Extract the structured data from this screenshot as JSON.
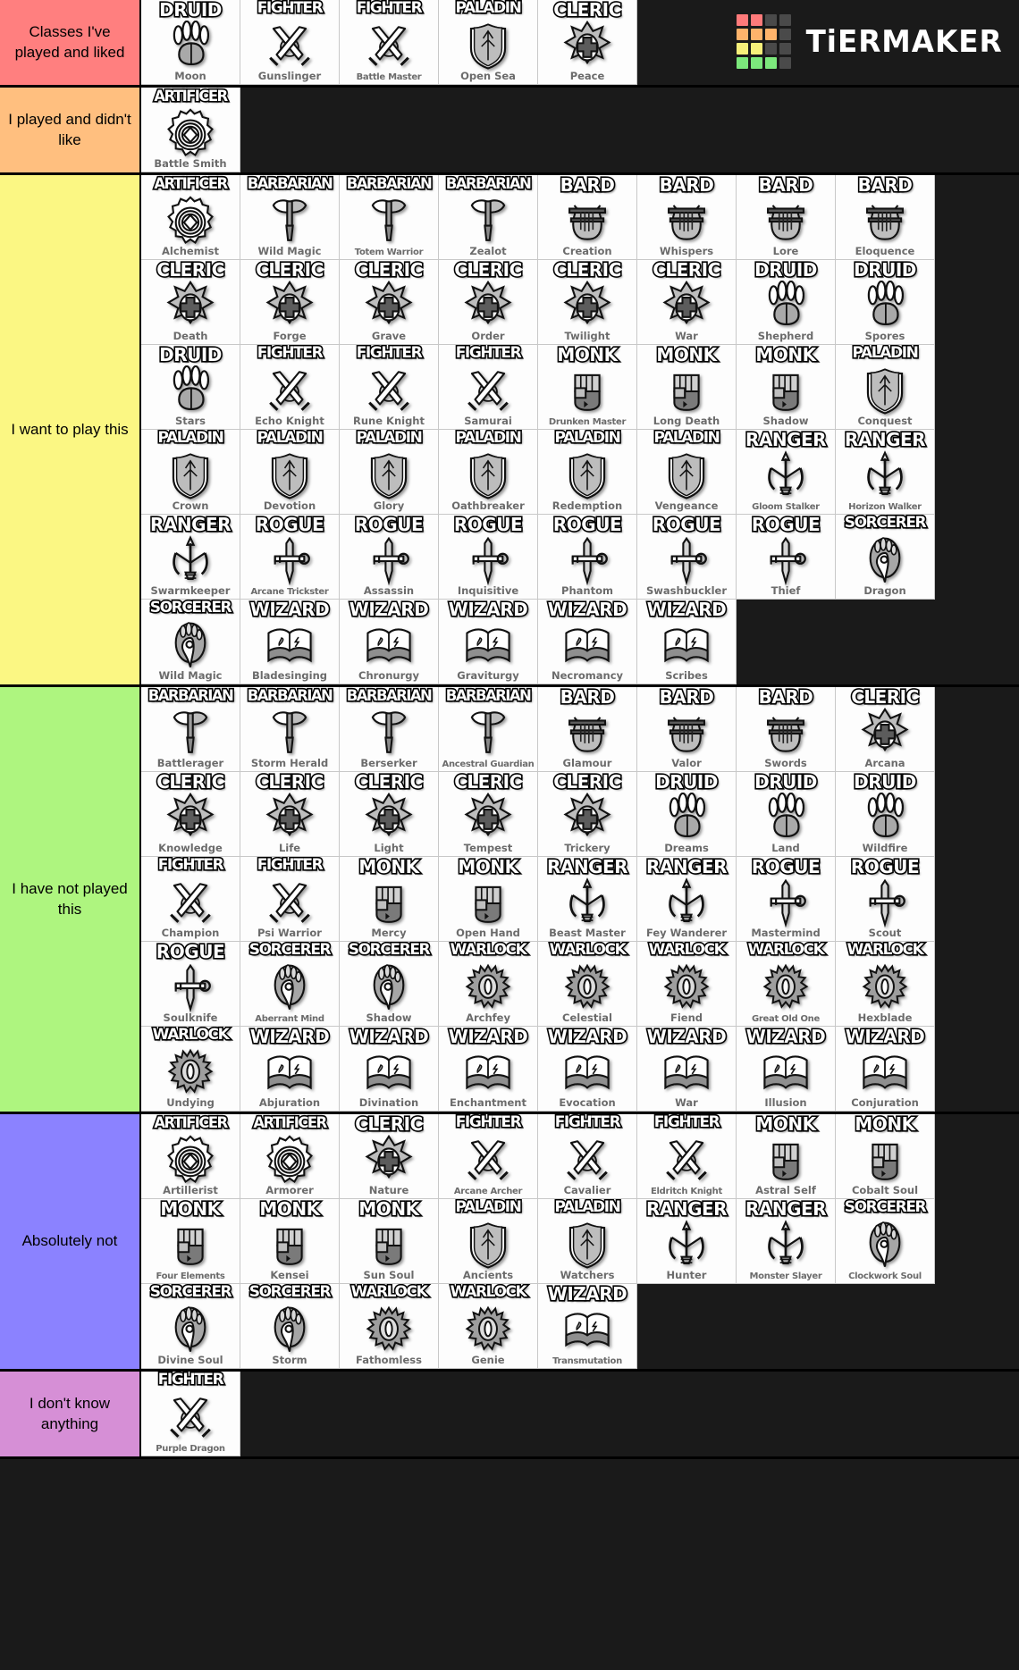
{
  "brand": {
    "name": "TiERMAKER",
    "logo_colors": [
      [
        "#ff7a7a",
        "#ff7a7a",
        "#4a4a4a",
        "#4a4a4a"
      ],
      [
        "#ffb36b",
        "#ffb36b",
        "#ffb36b",
        "#4a4a4a"
      ],
      [
        "#f7f07a",
        "#f7f07a",
        "#4a4a4a",
        "#4a4a4a"
      ],
      [
        "#7ce87c",
        "#7ce87c",
        "#7ce87c",
        "#4a4a4a"
      ]
    ]
  },
  "tiers": [
    {
      "label": "Classes I've played and liked",
      "color": "#ff7f7f",
      "items": [
        {
          "cls": "DRUID",
          "sub": "Moon",
          "icon": "paw-icon"
        },
        {
          "cls": "FIGHTER",
          "sub": "Gunslinger",
          "icon": "swords-icon"
        },
        {
          "cls": "FIGHTER",
          "sub": "Battle Master",
          "icon": "swords-icon"
        },
        {
          "cls": "PALADIN",
          "sub": "Open Sea",
          "icon": "shield-icon"
        },
        {
          "cls": "CLERIC",
          "sub": "Peace",
          "icon": "cross-icon"
        }
      ]
    },
    {
      "label": "I played and didn't like",
      "color": "#ffbf7f",
      "items": [
        {
          "cls": "ARTIFICER",
          "sub": "Battle Smith",
          "icon": "gear-icon"
        }
      ]
    },
    {
      "label": "I want to play this",
      "color": "#fbf783",
      "items": [
        {
          "cls": "ARTIFICER",
          "sub": "Alchemist",
          "icon": "gear-icon"
        },
        {
          "cls": "BARBARIAN",
          "sub": "Wild Magic",
          "icon": "axe-icon"
        },
        {
          "cls": "BARBARIAN",
          "sub": "Totem Warrior",
          "icon": "axe-icon"
        },
        {
          "cls": "BARBARIAN",
          "sub": "Zealot",
          "icon": "axe-icon"
        },
        {
          "cls": "BARD",
          "sub": "Creation",
          "icon": "lyre-icon"
        },
        {
          "cls": "BARD",
          "sub": "Whispers",
          "icon": "lyre-icon"
        },
        {
          "cls": "BARD",
          "sub": "Lore",
          "icon": "lyre-icon"
        },
        {
          "cls": "BARD",
          "sub": "Eloquence",
          "icon": "lyre-icon"
        },
        {
          "cls": "CLERIC",
          "sub": "Death",
          "icon": "cross-icon"
        },
        {
          "cls": "CLERIC",
          "sub": "Forge",
          "icon": "cross-icon"
        },
        {
          "cls": "CLERIC",
          "sub": "Grave",
          "icon": "cross-icon"
        },
        {
          "cls": "CLERIC",
          "sub": "Order",
          "icon": "cross-icon"
        },
        {
          "cls": "CLERIC",
          "sub": "Twilight",
          "icon": "cross-icon"
        },
        {
          "cls": "CLERIC",
          "sub": "War",
          "icon": "cross-icon"
        },
        {
          "cls": "DRUID",
          "sub": "Shepherd",
          "icon": "paw-icon"
        },
        {
          "cls": "DRUID",
          "sub": "Spores",
          "icon": "paw-icon"
        },
        {
          "cls": "DRUID",
          "sub": "Stars",
          "icon": "paw-icon"
        },
        {
          "cls": "FIGHTER",
          "sub": "Echo Knight",
          "icon": "swords-icon"
        },
        {
          "cls": "FIGHTER",
          "sub": "Rune Knight",
          "icon": "swords-icon"
        },
        {
          "cls": "FIGHTER",
          "sub": "Samurai",
          "icon": "swords-icon"
        },
        {
          "cls": "MONK",
          "sub": "Drunken Master",
          "icon": "fist-icon"
        },
        {
          "cls": "MONK",
          "sub": "Long Death",
          "icon": "fist-icon"
        },
        {
          "cls": "MONK",
          "sub": "Shadow",
          "icon": "fist-icon"
        },
        {
          "cls": "PALADIN",
          "sub": "Conquest",
          "icon": "shield-icon"
        },
        {
          "cls": "PALADIN",
          "sub": "Crown",
          "icon": "shield-icon"
        },
        {
          "cls": "PALADIN",
          "sub": "Devotion",
          "icon": "shield-icon"
        },
        {
          "cls": "PALADIN",
          "sub": "Glory",
          "icon": "shield-icon"
        },
        {
          "cls": "PALADIN",
          "sub": "Oathbreaker",
          "icon": "shield-icon"
        },
        {
          "cls": "PALADIN",
          "sub": "Redemption",
          "icon": "shield-icon"
        },
        {
          "cls": "PALADIN",
          "sub": "Vengeance",
          "icon": "shield-icon"
        },
        {
          "cls": "RANGER",
          "sub": "Gloom Stalker",
          "icon": "bow-icon"
        },
        {
          "cls": "RANGER",
          "sub": "Horizon Walker",
          "icon": "bow-icon"
        },
        {
          "cls": "RANGER",
          "sub": "Swarmkeeper",
          "icon": "bow-icon"
        },
        {
          "cls": "ROGUE",
          "sub": "Arcane Trickster",
          "icon": "dagger-icon"
        },
        {
          "cls": "ROGUE",
          "sub": "Assassin",
          "icon": "dagger-icon"
        },
        {
          "cls": "ROGUE",
          "sub": "Inquisitive",
          "icon": "dagger-icon"
        },
        {
          "cls": "ROGUE",
          "sub": "Phantom",
          "icon": "dagger-icon"
        },
        {
          "cls": "ROGUE",
          "sub": "Swashbuckler",
          "icon": "dagger-icon"
        },
        {
          "cls": "ROGUE",
          "sub": "Thief",
          "icon": "dagger-icon"
        },
        {
          "cls": "SORCERER",
          "sub": "Dragon",
          "icon": "flame-icon"
        },
        {
          "cls": "SORCERER",
          "sub": "Wild Magic",
          "icon": "flame-icon"
        },
        {
          "cls": "WIZARD",
          "sub": "Bladesinging",
          "icon": "book-icon"
        },
        {
          "cls": "WIZARD",
          "sub": "Chronurgy",
          "icon": "book-icon"
        },
        {
          "cls": "WIZARD",
          "sub": "Graviturgy",
          "icon": "book-icon"
        },
        {
          "cls": "WIZARD",
          "sub": "Necromancy",
          "icon": "book-icon"
        },
        {
          "cls": "WIZARD",
          "sub": "Scribes",
          "icon": "book-icon"
        }
      ]
    },
    {
      "label": "I have not played this",
      "color": "#aef57f",
      "items": [
        {
          "cls": "BARBARIAN",
          "sub": "Battlerager",
          "icon": "axe-icon"
        },
        {
          "cls": "BARBARIAN",
          "sub": "Storm Herald",
          "icon": "axe-icon"
        },
        {
          "cls": "BARBARIAN",
          "sub": "Berserker",
          "icon": "axe-icon"
        },
        {
          "cls": "BARBARIAN",
          "sub": "Ancestral Guardian",
          "icon": "axe-icon"
        },
        {
          "cls": "BARD",
          "sub": "Glamour",
          "icon": "lyre-icon"
        },
        {
          "cls": "BARD",
          "sub": "Valor",
          "icon": "lyre-icon"
        },
        {
          "cls": "BARD",
          "sub": "Swords",
          "icon": "lyre-icon"
        },
        {
          "cls": "CLERIC",
          "sub": "Arcana",
          "icon": "cross-icon"
        },
        {
          "cls": "CLERIC",
          "sub": "Knowledge",
          "icon": "cross-icon"
        },
        {
          "cls": "CLERIC",
          "sub": "Life",
          "icon": "cross-icon"
        },
        {
          "cls": "CLERIC",
          "sub": "Light",
          "icon": "cross-icon"
        },
        {
          "cls": "CLERIC",
          "sub": "Tempest",
          "icon": "cross-icon"
        },
        {
          "cls": "CLERIC",
          "sub": "Trickery",
          "icon": "cross-icon"
        },
        {
          "cls": "DRUID",
          "sub": "Dreams",
          "icon": "paw-icon"
        },
        {
          "cls": "DRUID",
          "sub": "Land",
          "icon": "paw-icon"
        },
        {
          "cls": "DRUID",
          "sub": "Wildfire",
          "icon": "paw-icon"
        },
        {
          "cls": "FIGHTER",
          "sub": "Champion",
          "icon": "swords-icon"
        },
        {
          "cls": "FIGHTER",
          "sub": "Psi Warrior",
          "icon": "swords-icon"
        },
        {
          "cls": "MONK",
          "sub": "Mercy",
          "icon": "fist-icon"
        },
        {
          "cls": "MONK",
          "sub": "Open Hand",
          "icon": "fist-icon"
        },
        {
          "cls": "RANGER",
          "sub": "Beast Master",
          "icon": "bow-icon"
        },
        {
          "cls": "RANGER",
          "sub": "Fey Wanderer",
          "icon": "bow-icon"
        },
        {
          "cls": "ROGUE",
          "sub": "Mastermind",
          "icon": "dagger-icon"
        },
        {
          "cls": "ROGUE",
          "sub": "Scout",
          "icon": "dagger-icon"
        },
        {
          "cls": "ROGUE",
          "sub": "Soulknife",
          "icon": "dagger-icon"
        },
        {
          "cls": "SORCERER",
          "sub": "Aberrant Mind",
          "icon": "flame-icon"
        },
        {
          "cls": "SORCERER",
          "sub": "Shadow",
          "icon": "flame-icon"
        },
        {
          "cls": "WARLOCK",
          "sub": "Archfey",
          "icon": "eye-icon"
        },
        {
          "cls": "WARLOCK",
          "sub": "Celestial",
          "icon": "eye-icon"
        },
        {
          "cls": "WARLOCK",
          "sub": "Fiend",
          "icon": "eye-icon"
        },
        {
          "cls": "WARLOCK",
          "sub": "Great Old One",
          "icon": "eye-icon"
        },
        {
          "cls": "WARLOCK",
          "sub": "Hexblade",
          "icon": "eye-icon"
        },
        {
          "cls": "WARLOCK",
          "sub": "Undying",
          "icon": "eye-icon"
        },
        {
          "cls": "WIZARD",
          "sub": "Abjuration",
          "icon": "book-icon"
        },
        {
          "cls": "WIZARD",
          "sub": "Divination",
          "icon": "book-icon"
        },
        {
          "cls": "WIZARD",
          "sub": "Enchantment",
          "icon": "book-icon"
        },
        {
          "cls": "WIZARD",
          "sub": "Evocation",
          "icon": "book-icon"
        },
        {
          "cls": "WIZARD",
          "sub": "War",
          "icon": "book-icon"
        },
        {
          "cls": "WIZARD",
          "sub": "Illusion",
          "icon": "book-icon"
        },
        {
          "cls": "WIZARD",
          "sub": "Conjuration",
          "icon": "book-icon"
        }
      ]
    },
    {
      "label": "Absolutely not",
      "color": "#8b82ff",
      "items": [
        {
          "cls": "ARTIFICER",
          "sub": "Artillerist",
          "icon": "gear-icon"
        },
        {
          "cls": "ARTIFICER",
          "sub": "Armorer",
          "icon": "gear-icon"
        },
        {
          "cls": "CLERIC",
          "sub": "Nature",
          "icon": "cross-icon"
        },
        {
          "cls": "FIGHTER",
          "sub": "Arcane Archer",
          "icon": "swords-icon"
        },
        {
          "cls": "FIGHTER",
          "sub": "Cavalier",
          "icon": "swords-icon"
        },
        {
          "cls": "FIGHTER",
          "sub": "Eldritch Knight",
          "icon": "swords-icon"
        },
        {
          "cls": "MONK",
          "sub": "Astral Self",
          "icon": "fist-icon"
        },
        {
          "cls": "MONK",
          "sub": "Cobalt Soul",
          "icon": "fist-icon"
        },
        {
          "cls": "MONK",
          "sub": "Four Elements",
          "icon": "fist-icon"
        },
        {
          "cls": "MONK",
          "sub": "Kensei",
          "icon": "fist-icon"
        },
        {
          "cls": "MONK",
          "sub": "Sun Soul",
          "icon": "fist-icon"
        },
        {
          "cls": "PALADIN",
          "sub": "Ancients",
          "icon": "shield-icon"
        },
        {
          "cls": "PALADIN",
          "sub": "Watchers",
          "icon": "shield-icon"
        },
        {
          "cls": "RANGER",
          "sub": "Hunter",
          "icon": "bow-icon"
        },
        {
          "cls": "RANGER",
          "sub": "Monster Slayer",
          "icon": "bow-icon"
        },
        {
          "cls": "SORCERER",
          "sub": "Clockwork Soul",
          "icon": "flame-icon"
        },
        {
          "cls": "SORCERER",
          "sub": "Divine Soul",
          "icon": "flame-icon"
        },
        {
          "cls": "SORCERER",
          "sub": "Storm",
          "icon": "flame-icon"
        },
        {
          "cls": "WARLOCK",
          "sub": "Fathomless",
          "icon": "eye-icon"
        },
        {
          "cls": "WARLOCK",
          "sub": "Genie",
          "icon": "eye-icon"
        },
        {
          "cls": "WIZARD",
          "sub": "Transmutation",
          "icon": "book-icon"
        }
      ]
    },
    {
      "label": "I don't know anything",
      "color": "#d68fd6",
      "items": [
        {
          "cls": "FIGHTER",
          "sub": "Purple Dragon",
          "icon": "swords-icon"
        }
      ]
    }
  ]
}
